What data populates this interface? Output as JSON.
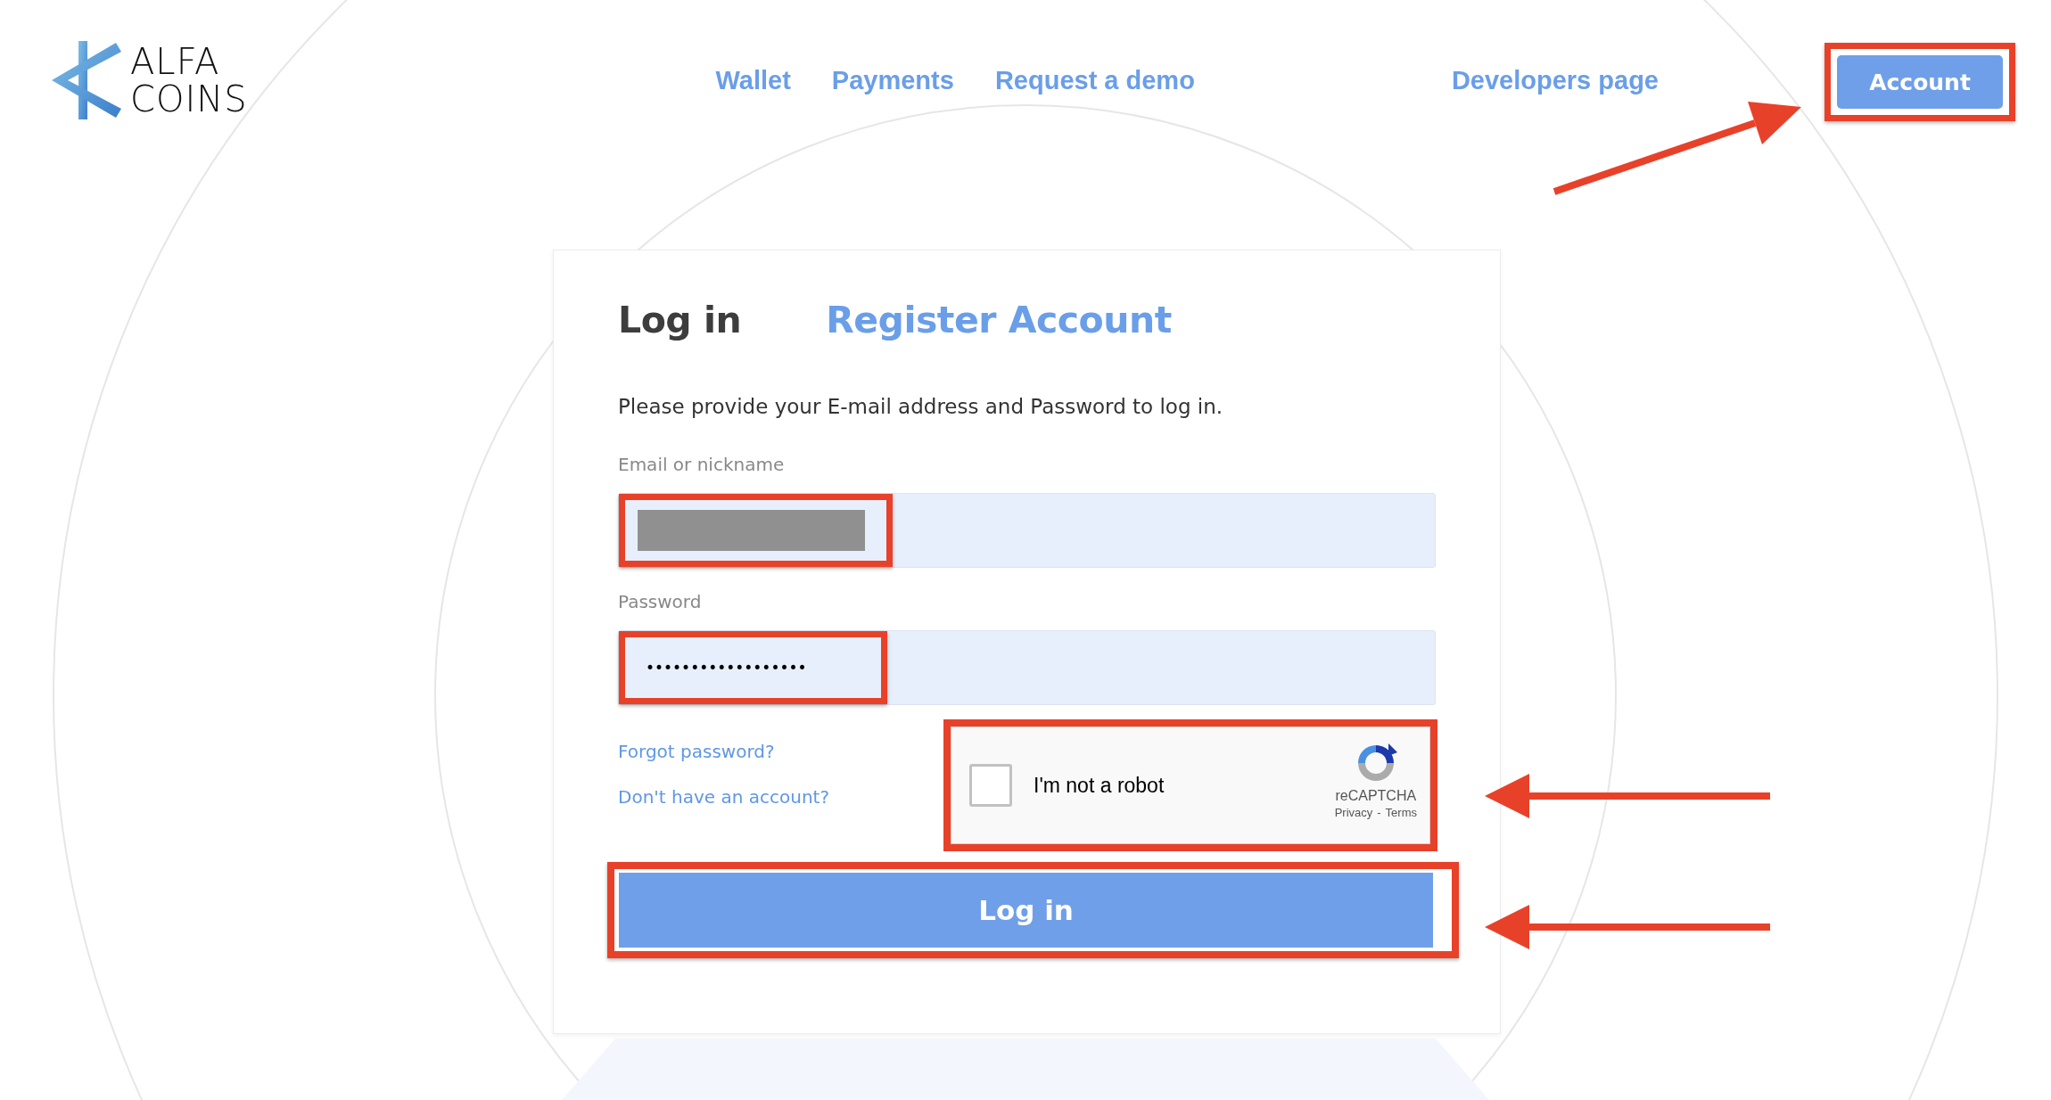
{
  "logo": {
    "line_1": "ALFA",
    "line_2": "COINS"
  },
  "nav": {
    "links": [
      {
        "label": "Wallet"
      },
      {
        "label": "Payments"
      },
      {
        "label": "Request a demo"
      }
    ],
    "developers_link": "Developers page",
    "account_button": {
      "label": "Account",
      "highlighted": true
    }
  },
  "login_card": {
    "tabs": [
      {
        "label": "Log in",
        "selected": true
      },
      {
        "label": "Register Account",
        "selected": false
      }
    ],
    "description": "Please provide your E-mail address and Password to log in.",
    "email_field": {
      "label": "Email or nickname",
      "redacted": true,
      "highlighted": true
    },
    "password_field": {
      "label": "Password",
      "value": "••••••••••••••••••",
      "highlighted": true
    },
    "links": [
      {
        "label": "Forgot password?"
      },
      {
        "label": "Don't have an account?"
      }
    ],
    "captcha": {
      "label": "I'm not a robot",
      "checked": false,
      "brand": "reCAPTCHA",
      "privacy": "Privacy",
      "separator": "-",
      "terms": "Terms",
      "highlighted": true
    },
    "login_button": {
      "label": "Log in",
      "highlighted": true
    }
  }
}
